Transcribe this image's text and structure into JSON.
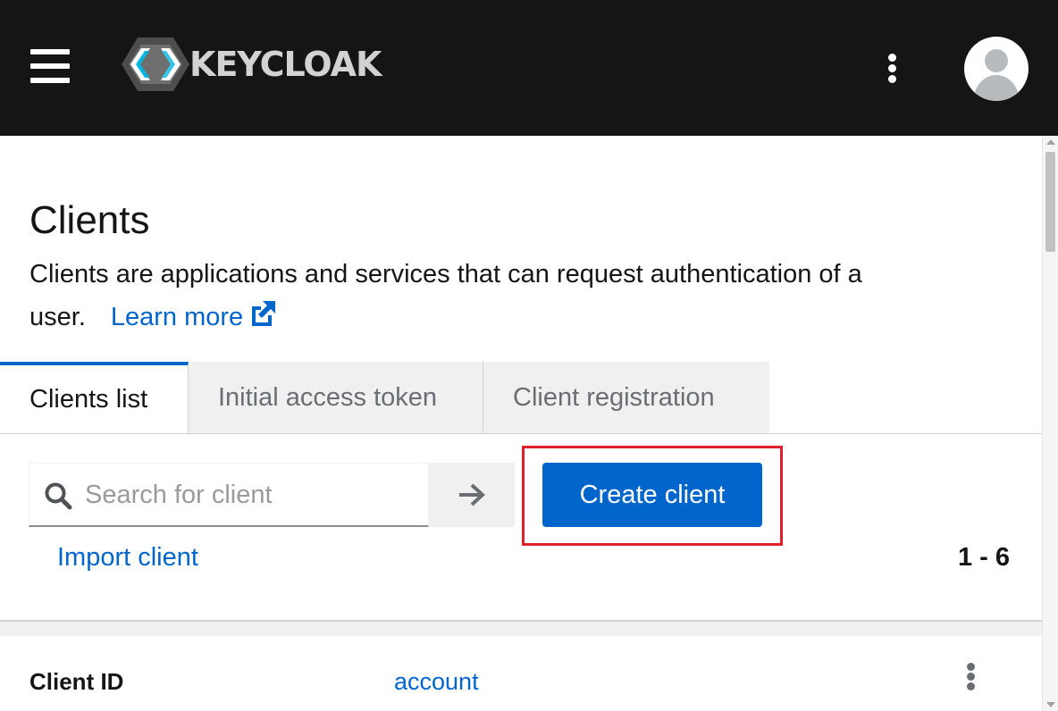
{
  "header": {
    "menu_icon": "hamburger-icon",
    "logo_text": "KEYCLOAK",
    "kebab_icon": "kebab-vertical-icon",
    "avatar_icon": "user-avatar-icon"
  },
  "page": {
    "title": "Clients",
    "description": "Clients are applications and services that can request authentication of a user.",
    "learn_more": "Learn more",
    "learn_more_icon": "external-link-icon"
  },
  "tabs": [
    {
      "label": "Clients list",
      "active": true
    },
    {
      "label": "Initial access token",
      "active": false
    },
    {
      "label": "Client registration",
      "active": false
    }
  ],
  "toolbar": {
    "search_placeholder": "Search for client",
    "search_value": "",
    "search_icon": "search-icon",
    "search_go_icon": "arrow-right-icon",
    "create_label": "Create client",
    "import_label": "Import client",
    "pagination": "1 - 6"
  },
  "table": {
    "rows": [
      {
        "label": "Client ID",
        "value": "account"
      }
    ]
  },
  "colors": {
    "masthead": "#151515",
    "primary": "#0066cc",
    "highlight": "#e0202c"
  }
}
